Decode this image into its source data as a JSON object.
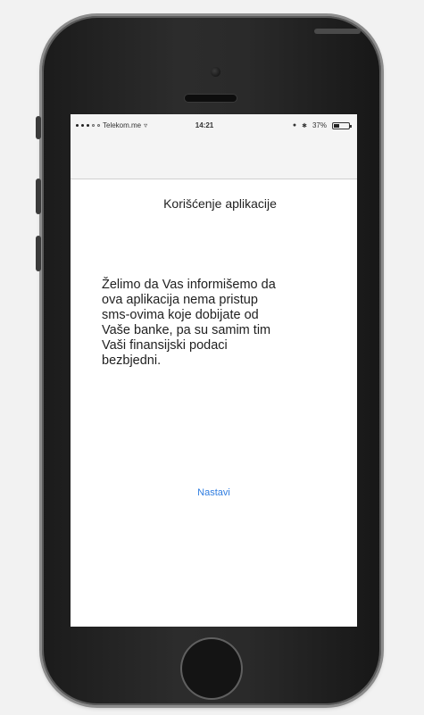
{
  "status_bar": {
    "carrier": "Telekom.me",
    "time": "14:21",
    "battery_text": "37%",
    "battery_level": 0.37
  },
  "screen": {
    "title": "Korišćenje aplikacije",
    "message": "Želimo da Vas informišemo da\nova aplikacija nema pristup\nsms-ovima koje dobijate od\nVaše banke, pa su samim tim\nVaši finansijski podaci\nbezbjedni.",
    "continue_label": "Nastavi"
  },
  "colors": {
    "link_blue": "#2f7de0",
    "phone_body": "#222222",
    "screen_bg": "#ffffff"
  }
}
